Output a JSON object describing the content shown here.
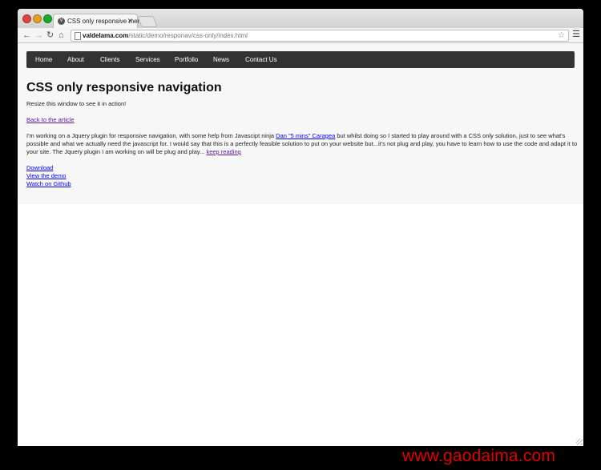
{
  "browser": {
    "tab_title": "CSS only responsive menu",
    "url_host": "valdelama.com",
    "url_path": "/static/demo/responav/css-only/index.html"
  },
  "nav": {
    "items": [
      "Home",
      "About",
      "Clients",
      "Services",
      "Portfolio",
      "News",
      "Contact Us"
    ]
  },
  "page": {
    "title": "CSS only responsive navigation",
    "subtitle": "Resize this window to see it in action!",
    "back_link": "Back to the article",
    "intro_before": "I'm working on a Jquery plugin for responsive navigation, with some help from Javascipt ninja ",
    "intro_link": "Dan \"5 mins\" Caragea",
    "intro_line1_after": " but whilst doing so I started to play around with a CSS only solution, just to see what's",
    "intro_line2": "possible and what we actually need the javascript for. I would say that this is a perfectly feasible solution to put on your website but...it's not plug and play, you have to learn how to use the code and adapt it to",
    "intro_line3": "your site. The Jquery plugin I am working on will be plug and play... ",
    "keep_reading": "keep reading",
    "links": [
      "Download",
      "View the demo",
      "Watch on Github"
    ]
  },
  "watermark": "www.gaodaima.com"
}
